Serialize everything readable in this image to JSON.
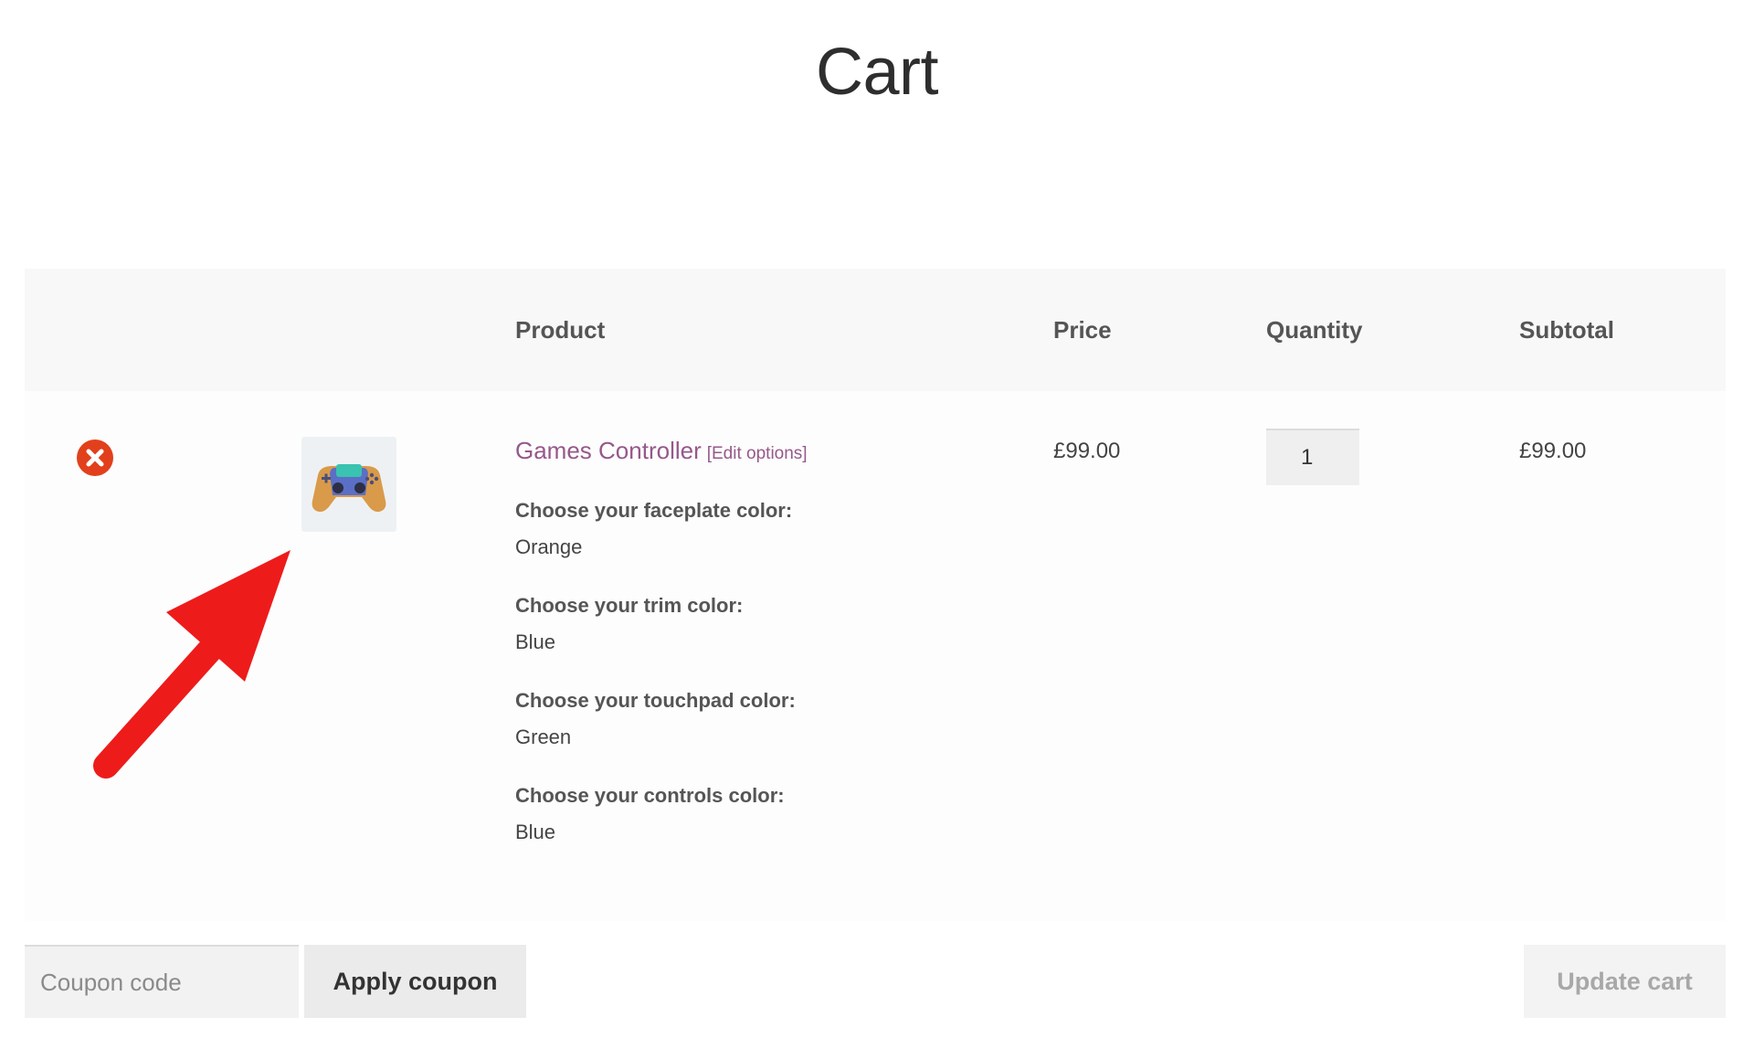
{
  "page": {
    "title": "Cart"
  },
  "cart": {
    "columns": {
      "product": "Product",
      "price": "Price",
      "quantity": "Quantity",
      "subtotal": "Subtotal"
    },
    "items": [
      {
        "name": "Games Controller",
        "edit_link": "[Edit options]",
        "price": "£99.00",
        "quantity": "1",
        "subtotal": "£99.00",
        "thumbnail_icon": "gamepad-icon",
        "options": [
          {
            "label": "Choose your faceplate color:",
            "value": "Orange"
          },
          {
            "label": "Choose your trim color:",
            "value": "Blue"
          },
          {
            "label": "Choose your touchpad color:",
            "value": "Green"
          },
          {
            "label": "Choose your controls color:",
            "value": "Blue"
          }
        ]
      }
    ]
  },
  "actions": {
    "coupon_placeholder": "Coupon code",
    "apply_label": "Apply coupon",
    "update_label": "Update cart"
  },
  "colors": {
    "accent": "#96588a",
    "remove": "#e2401c",
    "annotation_arrow": "#ee1b1b"
  },
  "annotation": {
    "icon": "red-arrow-icon"
  }
}
